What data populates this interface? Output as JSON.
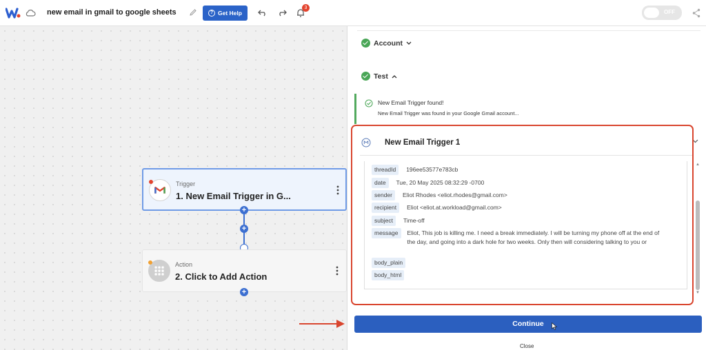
{
  "topbar": {
    "title": "new email in gmail to google sheets",
    "help_label": "Get Help",
    "notification_count": "3",
    "toggle_label": "OFF"
  },
  "canvas": {
    "trigger": {
      "kind": "Trigger",
      "name": "1. New Email Trigger in G..."
    },
    "action": {
      "kind": "Action",
      "name": "2. Click to Add Action"
    }
  },
  "panel": {
    "account_label": "Account",
    "test_label": "Test",
    "found_title": "New Email Trigger found!",
    "found_desc": "New Email Trigger was found in your Google Gmail account...",
    "trigger_title": "New Email Trigger 1",
    "fields": [
      {
        "key": "threadId",
        "value": "196ee53577e783cb"
      },
      {
        "key": "date",
        "value": "Tue, 20 May 2025 08:32:29 -0700"
      },
      {
        "key": "sender",
        "value": "Eliot Rhodes <eliot.rhodes@gmail.com>"
      },
      {
        "key": "recipient",
        "value": "Eliot <eliot.at.workload@gmail.com>"
      },
      {
        "key": "subject",
        "value": "Time-off"
      },
      {
        "key": "message",
        "value": "Eliot, This job is killing me. I need a break immediately. I will be turning my phone off at the end of the day, and going into a dark hole for two weeks. Only then will considering talking to you or"
      },
      {
        "key": "body_plain",
        "value": ""
      },
      {
        "key": "body_html",
        "value": ""
      }
    ],
    "continue_label": "Continue",
    "close_label": "Close"
  },
  "colors": {
    "accent": "#2b5fbf",
    "highlight_border": "#d9452e",
    "success": "#4aa657"
  }
}
